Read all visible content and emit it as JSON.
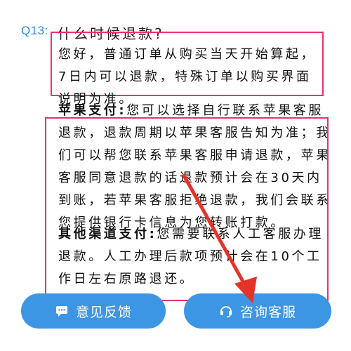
{
  "faq": {
    "question_number": "Q13:",
    "question": "什么时候退款?",
    "answer_general": "您好，普通订单从购买当天开始算起，7日内可以退款，特殊订单以购买界面说明为准。",
    "apple_heading": "苹果支付:",
    "apple_text": "您可以选择自行联系苹果客服退款，退款周期以苹果客服告知为准；我们可以帮您联系苹果客服申请退款，苹果客服同意退款的话退款预计会在30天内到账，若苹果客服拒绝退款，我们会联系您提供银行卡信息为您转账打款。",
    "other_heading": "其他渠道支付:",
    "other_text": "您需要联系人工客服办理退款。人工办理后款项预计会在10个工作日左右原路退还。"
  },
  "buttons": {
    "feedback_label": "意见反馈",
    "service_label": "咨询客服"
  },
  "icons": {
    "feedback": "chat-icon",
    "service": "headset-icon"
  },
  "colors": {
    "accent": "#3d96e4",
    "highlight_box": "#e8336b",
    "arrow": "#e5332a"
  }
}
